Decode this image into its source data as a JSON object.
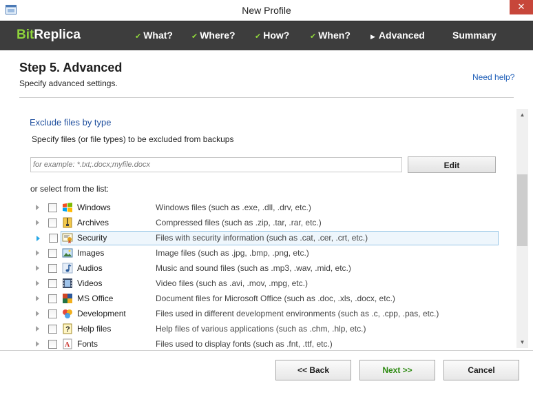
{
  "window": {
    "title": "New Profile",
    "close_glyph": "✕"
  },
  "nav": {
    "brand_prefix": "Bit",
    "brand_suffix": "Replica",
    "steps": [
      {
        "label": "What?",
        "state": "done"
      },
      {
        "label": "Where?",
        "state": "done"
      },
      {
        "label": "How?",
        "state": "done"
      },
      {
        "label": "When?",
        "state": "done"
      },
      {
        "label": "Advanced",
        "state": "current"
      },
      {
        "label": "Summary",
        "state": "pending"
      }
    ]
  },
  "header": {
    "title": "Step 5. Advanced",
    "subtitle": "Specify advanced settings.",
    "help_link": "Need help?"
  },
  "exclude": {
    "section_title": "Exclude files by type",
    "description": "Specify files (or file types) to be excluded from backups",
    "input_placeholder": "for example: *.txt;.docx;myfile.docx",
    "input_value": "",
    "edit_button": "Edit",
    "list_label": "or select from the list:",
    "items": [
      {
        "name": "Windows",
        "details": "Windows files (such as .exe, .dll, .drv, etc.)",
        "icon": "windows-logo-icon",
        "checked": false
      },
      {
        "name": "Archives",
        "details": "Compressed files (such as .zip, .tar, .rar, etc.)",
        "icon": "archive-icon",
        "checked": false
      },
      {
        "name": "Security",
        "details": "Files with security information (such as .cat, .cer, .crt, etc.)",
        "icon": "certificate-icon",
        "checked": false,
        "selected": true
      },
      {
        "name": "Images",
        "details": "Image files (such as .jpg, .bmp, .png, etc.)",
        "icon": "image-icon",
        "checked": false
      },
      {
        "name": "Audios",
        "details": "Music and sound files (such as .mp3, .wav, .mid, etc.)",
        "icon": "music-note-icon",
        "checked": false
      },
      {
        "name": "Videos",
        "details": "Video files (such as .avi, .mov, .mpg, etc.)",
        "icon": "film-icon",
        "checked": false
      },
      {
        "name": "MS Office",
        "details": "Document files for Microsoft Office (such as .doc, .xls, .docx, etc.)",
        "icon": "office-icon",
        "checked": false
      },
      {
        "name": "Development",
        "details": "Files used in different development environments (such as .c, .cpp, .pas, etc.)",
        "icon": "development-icon",
        "checked": false
      },
      {
        "name": "Help files",
        "details": "Help files of various applications (such as .chm, .hlp, etc.)",
        "icon": "help-file-icon",
        "checked": false
      },
      {
        "name": "Fonts",
        "details": "Files used to display fonts (such as .fnt, .ttf, etc.)",
        "icon": "font-icon",
        "checked": false
      }
    ]
  },
  "footer": {
    "back": "<< Back",
    "next": "Next >>",
    "cancel": "Cancel"
  },
  "colors": {
    "accent_green": "#8ed43b",
    "nav_background": "#3d3d3d",
    "link_blue": "#1f5fb8",
    "close_red": "#c7463a"
  }
}
